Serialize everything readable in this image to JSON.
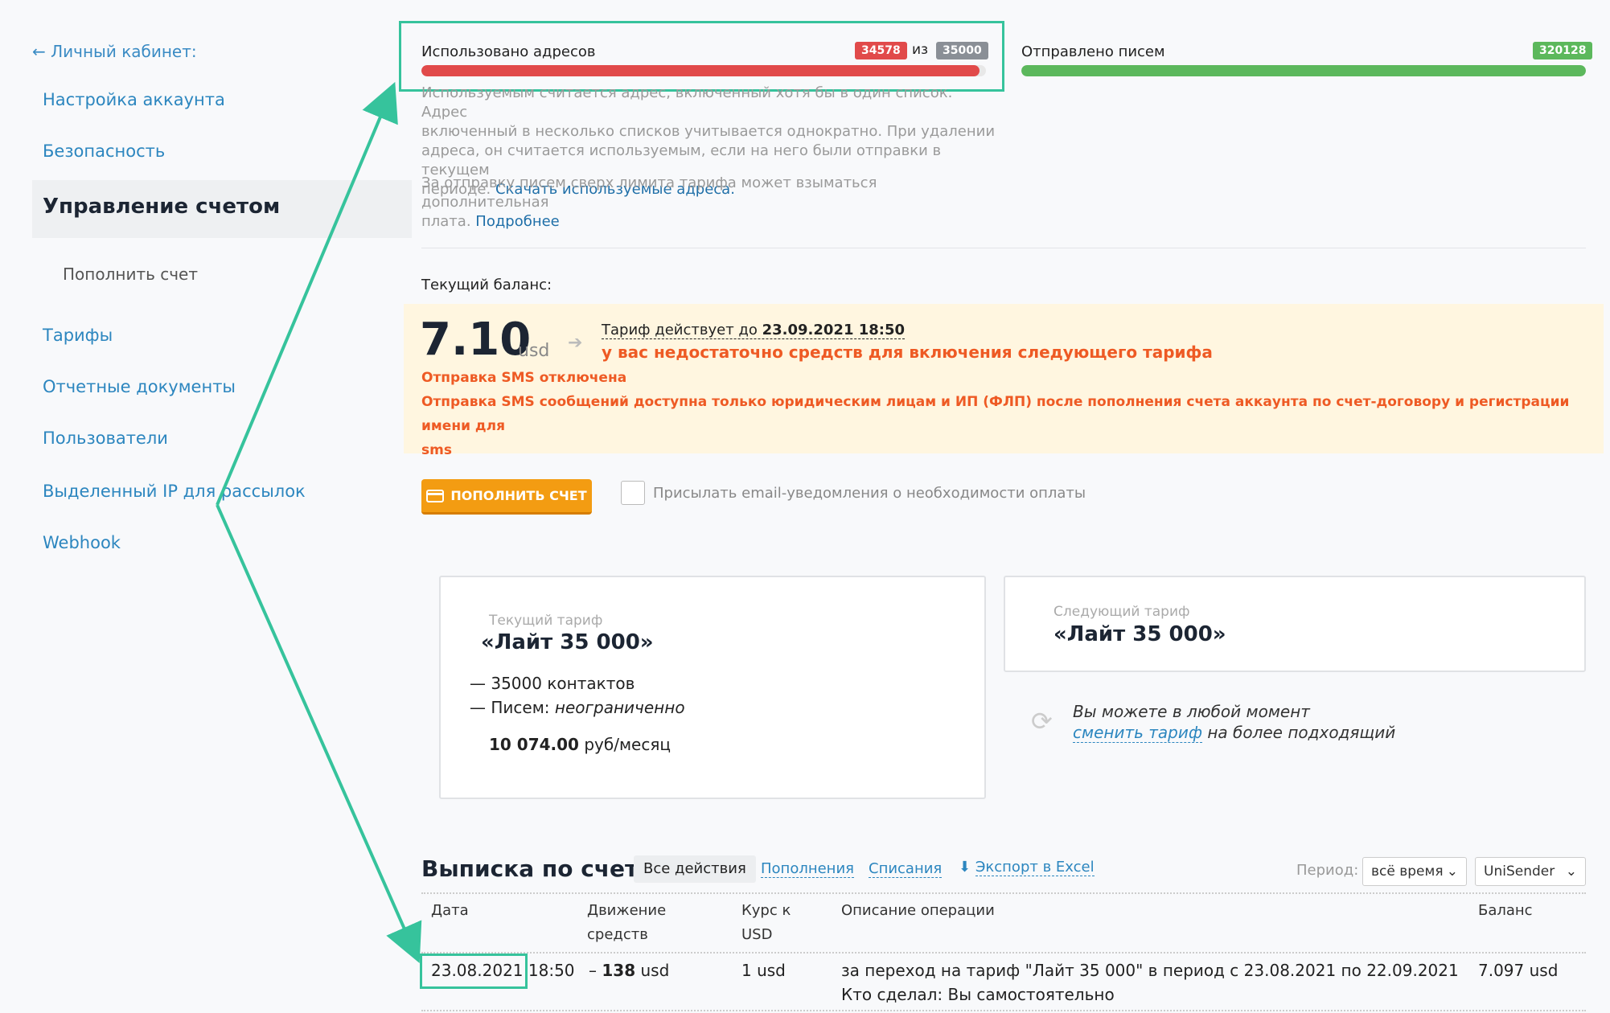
{
  "sidebar": {
    "back_label": "← Личный кабинет:",
    "items": [
      {
        "label": "Настройка аккаунта"
      },
      {
        "label": "Безопасность"
      },
      {
        "label": "Управление счетом"
      },
      {
        "label": "Пополнить счет"
      },
      {
        "label": "Тарифы"
      },
      {
        "label": "Отчетные документы"
      },
      {
        "label": "Пользователи"
      },
      {
        "label": "Выделенный IP для рассылок"
      },
      {
        "label": "Webhook"
      }
    ]
  },
  "usage": {
    "addresses_label": "Использовано адресов",
    "addresses_used": "34578",
    "addresses_of": "из",
    "addresses_limit": "35000",
    "addresses_fraction": 0.988,
    "sent_label": "Отправлено писем",
    "sent_count": "320128",
    "sent_fraction": 1.0,
    "note_line1": "Используемым считается адрес, включенный хотя бы в один список. Адрес",
    "note_line2": "включенный в несколько списков учитывается однократно. При удалении",
    "note_line3": "адреса, он считается используемым, если на него были отправки в текущем",
    "note_line4_prefix": "периоде.",
    "note_link": "Скачать используемые адреса.",
    "limit_line1": "За отправку писем сверх лимита тарифа может взыматься дополнительная",
    "limit_line2_prefix": "плата.",
    "limit_link": "Подробнее"
  },
  "balance": {
    "label": "Текущий баланс:",
    "amount": "7.10",
    "currency": "usd",
    "tariff_until_prefix": "Тариф действует до",
    "tariff_until_date": "23.09.2021 18:50",
    "insufficient": "у вас недостаточно средств для включения следующего тарифа",
    "sms_disabled": "Отправка SMS отключена",
    "sms_info_line1": "Отправка SMS сообщений доступна только юридическим лицам и ИП (ФЛП) после пополнения счета аккаунта по счет-договору и регистрации имени для",
    "sms_info_line2": "sms"
  },
  "actions": {
    "pay_button": "ПОПОЛНИТЬ СЧЕТ",
    "email_notify_label": "Присылать email-уведомления о необходимости оплаты"
  },
  "current_tariff": {
    "caption": "Текущий тариф",
    "name": "«Лайт 35 000»",
    "contacts": "— 35000 контактов",
    "letters_prefix": "— Писем:",
    "letters_value": "неограниченно",
    "price_value": "10 074.00",
    "price_unit": "руб/месяц"
  },
  "next_tariff": {
    "caption": "Следующий тариф",
    "name": "«Лайт 35 000»"
  },
  "change_hint": {
    "line1": "Вы можете в любой момент",
    "link": "сменить тариф",
    "line2_suffix": "на более подходящий"
  },
  "statement": {
    "title": "Выписка по счету",
    "tabs": [
      "Все действия",
      "Пополнения",
      "Списания"
    ],
    "export_label": "Экспорт в Excel",
    "period_label": "Период:",
    "period_value": "всё время",
    "provider_value": "UniSender",
    "columns": {
      "date": "Дата",
      "movement_1": "Движение",
      "movement_2": "средств",
      "rate_1": "Курс к",
      "rate_2": "USD",
      "description": "Описание операции",
      "balance": "Баланс"
    },
    "rows": [
      {
        "date": "23.08.2021",
        "time": "18:50",
        "movement_sign": "–",
        "movement_value": "138",
        "movement_unit": "usd",
        "rate": "1 usd",
        "description_1": "за переход на тариф \"Лайт 35 000\" в период с 23.08.2021 по 22.09.2021",
        "description_2": "Кто сделал: Вы самостоятельно",
        "balance": "7.097 usd"
      }
    ]
  },
  "colors": {
    "accent_green": "#36c39c",
    "error_orange": "#ee5a24",
    "link_blue": "#2c86bf",
    "bar_red": "#e14a4a",
    "bar_green": "#5cb85c",
    "button_orange": "#f39c12"
  }
}
